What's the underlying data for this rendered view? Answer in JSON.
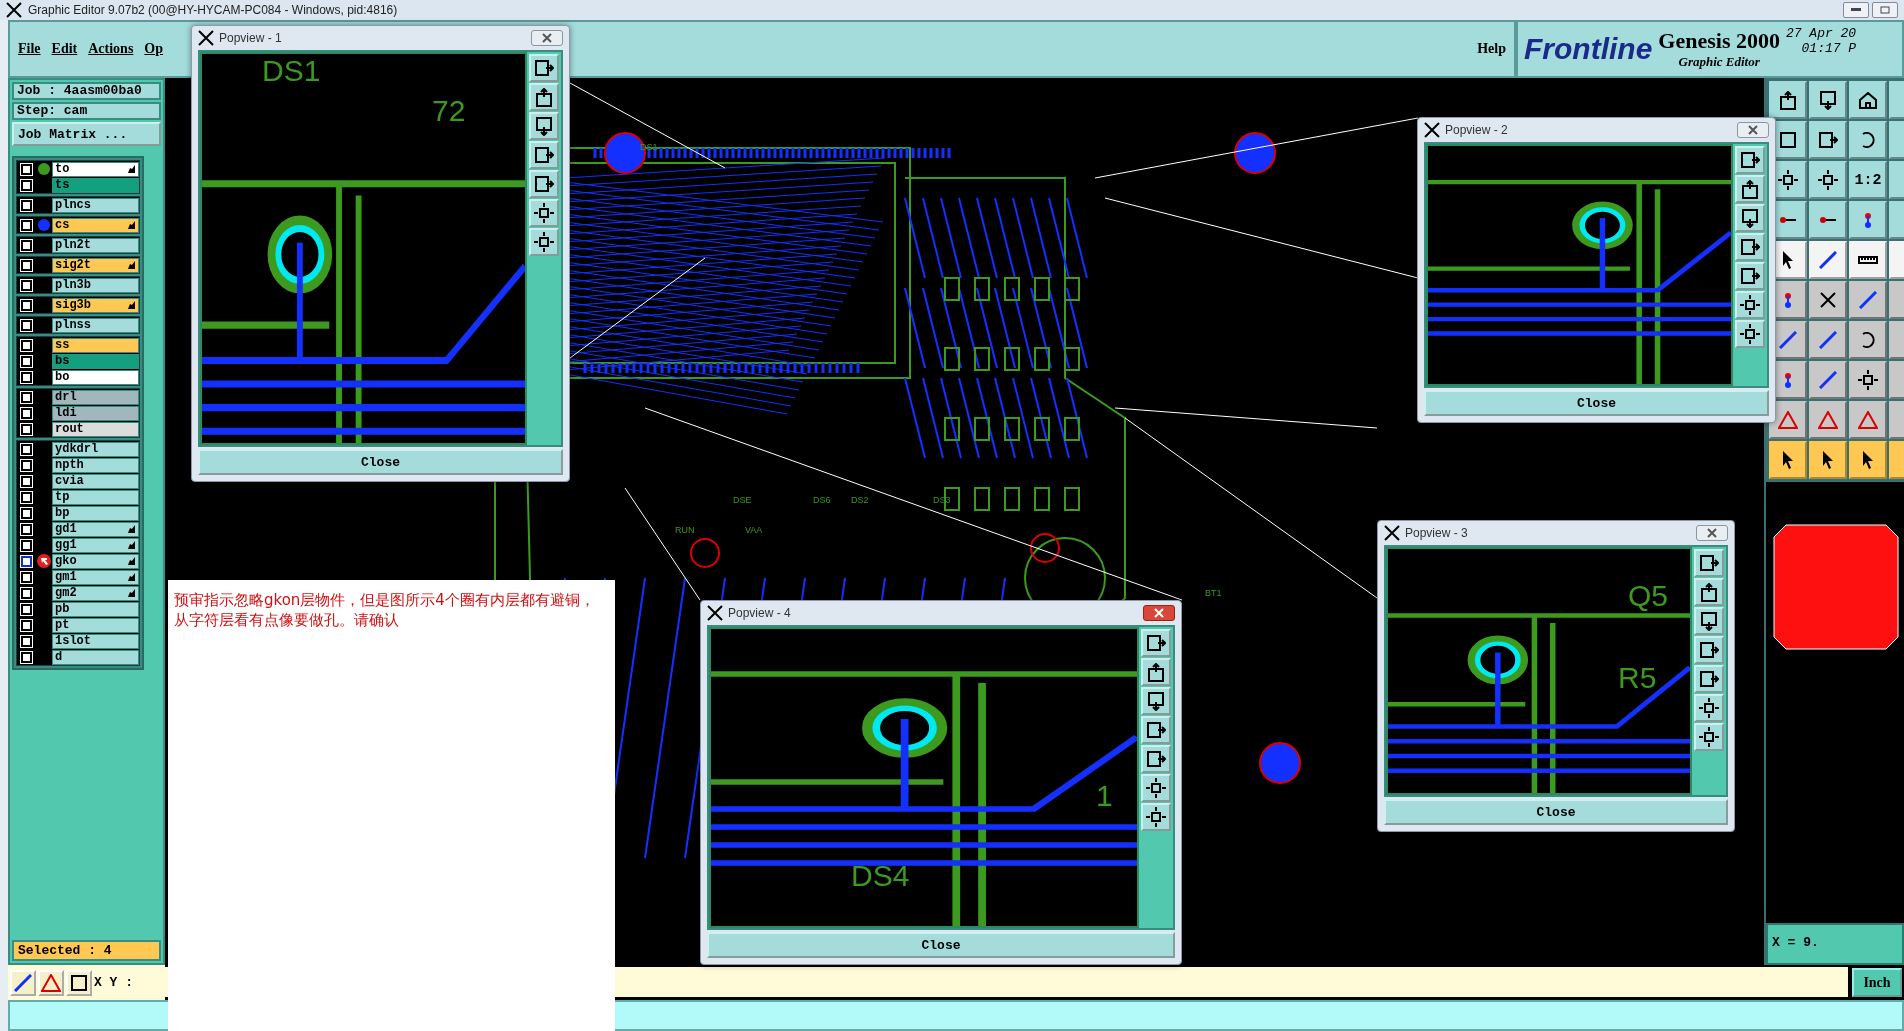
{
  "window": {
    "title": "Graphic Editor 9.07b2 (00@HY-HYCAM-PC084 - Windows, pid:4816)"
  },
  "menu": [
    "File",
    "Edit",
    "Actions",
    "Op"
  ],
  "help": "Help",
  "brand": {
    "logo": "Frontline",
    "product": "Genesis 2000",
    "subtitle": "Graphic Editor",
    "date": "27 Apr 20",
    "time": "01:17 P"
  },
  "job": {
    "job": "Job : 4aasm00ba0",
    "step": "Step: cam",
    "matrix_button": "Job Matrix ..."
  },
  "layer_groups": [
    {
      "layers": [
        {
          "name": "to",
          "color": "#ffffff",
          "dot": {
            "color": "#3c9a1e"
          },
          "affected": true,
          "checked": false,
          "work": false
        },
        {
          "name": "ts",
          "color": "#12a07e",
          "affected": false,
          "checked": false,
          "work": false
        }
      ]
    },
    {
      "layers": [
        {
          "name": "plncs",
          "color": "#a4dcdc",
          "affected": false,
          "checked": false,
          "work": false
        }
      ]
    },
    {
      "layers": [
        {
          "name": "cs",
          "color": "#ffc852",
          "dot": {
            "color": "#1430ff"
          },
          "affected": true,
          "checked": false,
          "work": false
        }
      ]
    },
    {
      "layers": [
        {
          "name": "pln2t",
          "color": "#a4dcdc",
          "affected": false,
          "checked": false,
          "work": false
        }
      ]
    },
    {
      "layers": [
        {
          "name": "sig2t",
          "color": "#ffc852",
          "affected": true,
          "checked": false,
          "work": false
        }
      ]
    },
    {
      "layers": [
        {
          "name": "pln3b",
          "color": "#a4dcdc",
          "affected": false,
          "checked": false,
          "work": false
        }
      ]
    },
    {
      "layers": [
        {
          "name": "sig3b",
          "color": "#ffc852",
          "affected": true,
          "checked": false,
          "work": false
        }
      ]
    },
    {
      "layers": [
        {
          "name": "plnss",
          "color": "#a4dcdc",
          "affected": false,
          "checked": false,
          "work": false
        }
      ]
    },
    {
      "layers": [
        {
          "name": "ss",
          "color": "#ffc852",
          "affected": false,
          "checked": false,
          "work": false
        },
        {
          "name": "bs",
          "color": "#12a07e",
          "affected": false,
          "checked": false,
          "work": false
        },
        {
          "name": "bo",
          "color": "#ffffff",
          "affected": false,
          "checked": false,
          "work": false
        }
      ]
    },
    {
      "layers": [
        {
          "name": "drl",
          "color": "#a2b6be",
          "affected": false,
          "checked": false,
          "work": false
        },
        {
          "name": "ldi",
          "color": "#a2b6be",
          "affected": false,
          "checked": false,
          "work": false
        },
        {
          "name": "rout",
          "color": "#dcdcdc",
          "affected": false,
          "checked": false,
          "work": false
        }
      ]
    },
    {
      "layers": [
        {
          "name": "ydkdrl",
          "color": "#a4dcdc",
          "affected": false,
          "checked": false,
          "work": false
        },
        {
          "name": "npth",
          "color": "#a4dcdc",
          "affected": false,
          "checked": false,
          "work": false
        },
        {
          "name": "cvia",
          "color": "#a4dcdc",
          "affected": false,
          "checked": false,
          "work": false
        },
        {
          "name": "tp",
          "color": "#a4dcdc",
          "affected": false,
          "checked": false,
          "work": false
        },
        {
          "name": "bp",
          "color": "#a4dcdc",
          "affected": false,
          "checked": false,
          "work": false
        },
        {
          "name": "gd1",
          "color": "#a4dcdc",
          "affected": true,
          "checked": false,
          "work": false
        },
        {
          "name": "gg1",
          "color": "#a4dcdc",
          "affected": true,
          "checked": false,
          "work": false
        },
        {
          "name": "gko",
          "color": "#a4dcdc",
          "affected": true,
          "checked": false,
          "work": true
        },
        {
          "name": "gm1",
          "color": "#a4dcdc",
          "affected": true,
          "checked": false,
          "work": false
        },
        {
          "name": "gm2",
          "color": "#a4dcdc",
          "affected": true,
          "checked": false,
          "work": false
        },
        {
          "name": "pb",
          "color": "#a4dcdc",
          "affected": false,
          "checked": false,
          "work": false
        },
        {
          "name": "pt",
          "color": "#a4dcdc",
          "affected": false,
          "checked": false,
          "work": false
        },
        {
          "name": "1slot",
          "color": "#a4dcdc",
          "affected": false,
          "checked": false,
          "work": false
        },
        {
          "name": "d",
          "color": "#a4dcdc",
          "affected": false,
          "checked": false,
          "work": false
        }
      ]
    }
  ],
  "selected_count": "Selected : 4",
  "xy_label": "X Y :",
  "coordinate": "X = 9.",
  "units_button": "Inch",
  "toolbar_text_button": "1:2",
  "canvas_labels": [
    "DS1",
    "RUN",
    "VAA",
    "DSE",
    "DS6",
    "DS2",
    "DS3",
    "BT1"
  ],
  "note": "预审指示忽略gkon层物件，但是图所示4个圈有内层都有避铜，从字符层看有点像要做孔。请确认",
  "popviews": [
    {
      "title": "Popview - 1",
      "active": false,
      "labels": [
        "DS1",
        "72"
      ],
      "close": "Close"
    },
    {
      "title": "Popview - 2",
      "active": false,
      "close": "Close"
    },
    {
      "title": "Popview - 3",
      "active": false,
      "labels": [
        "Q5",
        "R5"
      ],
      "close": "Close"
    },
    {
      "title": "Popview - 4",
      "active": true,
      "labels": [
        "1",
        "DS4"
      ],
      "close": "Close"
    }
  ]
}
